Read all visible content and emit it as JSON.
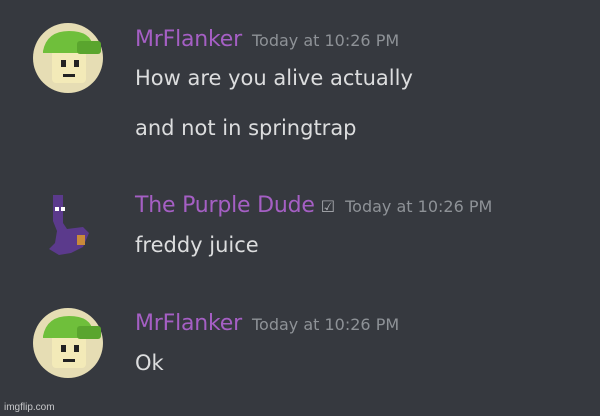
{
  "colors": {
    "background": "#36393f",
    "username": "#a55fc4",
    "text": "#dcddde",
    "timestamp": "#8e9297"
  },
  "messages": [
    {
      "author": "MrFlanker",
      "avatar_icon": "green-cap-avatar-icon",
      "timestamp": "Today at 10:26 PM",
      "lines": [
        "How are you alive actually",
        "and not in springtrap"
      ]
    },
    {
      "author": "The Purple Dude",
      "badge": "☑",
      "avatar_icon": "purple-ghost-avatar-icon",
      "timestamp": "Today at 10:26 PM",
      "lines": [
        "freddy juice"
      ]
    },
    {
      "author": "MrFlanker",
      "avatar_icon": "green-cap-avatar-icon",
      "timestamp": "Today at 10:26 PM",
      "lines": [
        "Ok"
      ]
    }
  ],
  "watermark": "imgflip.com"
}
